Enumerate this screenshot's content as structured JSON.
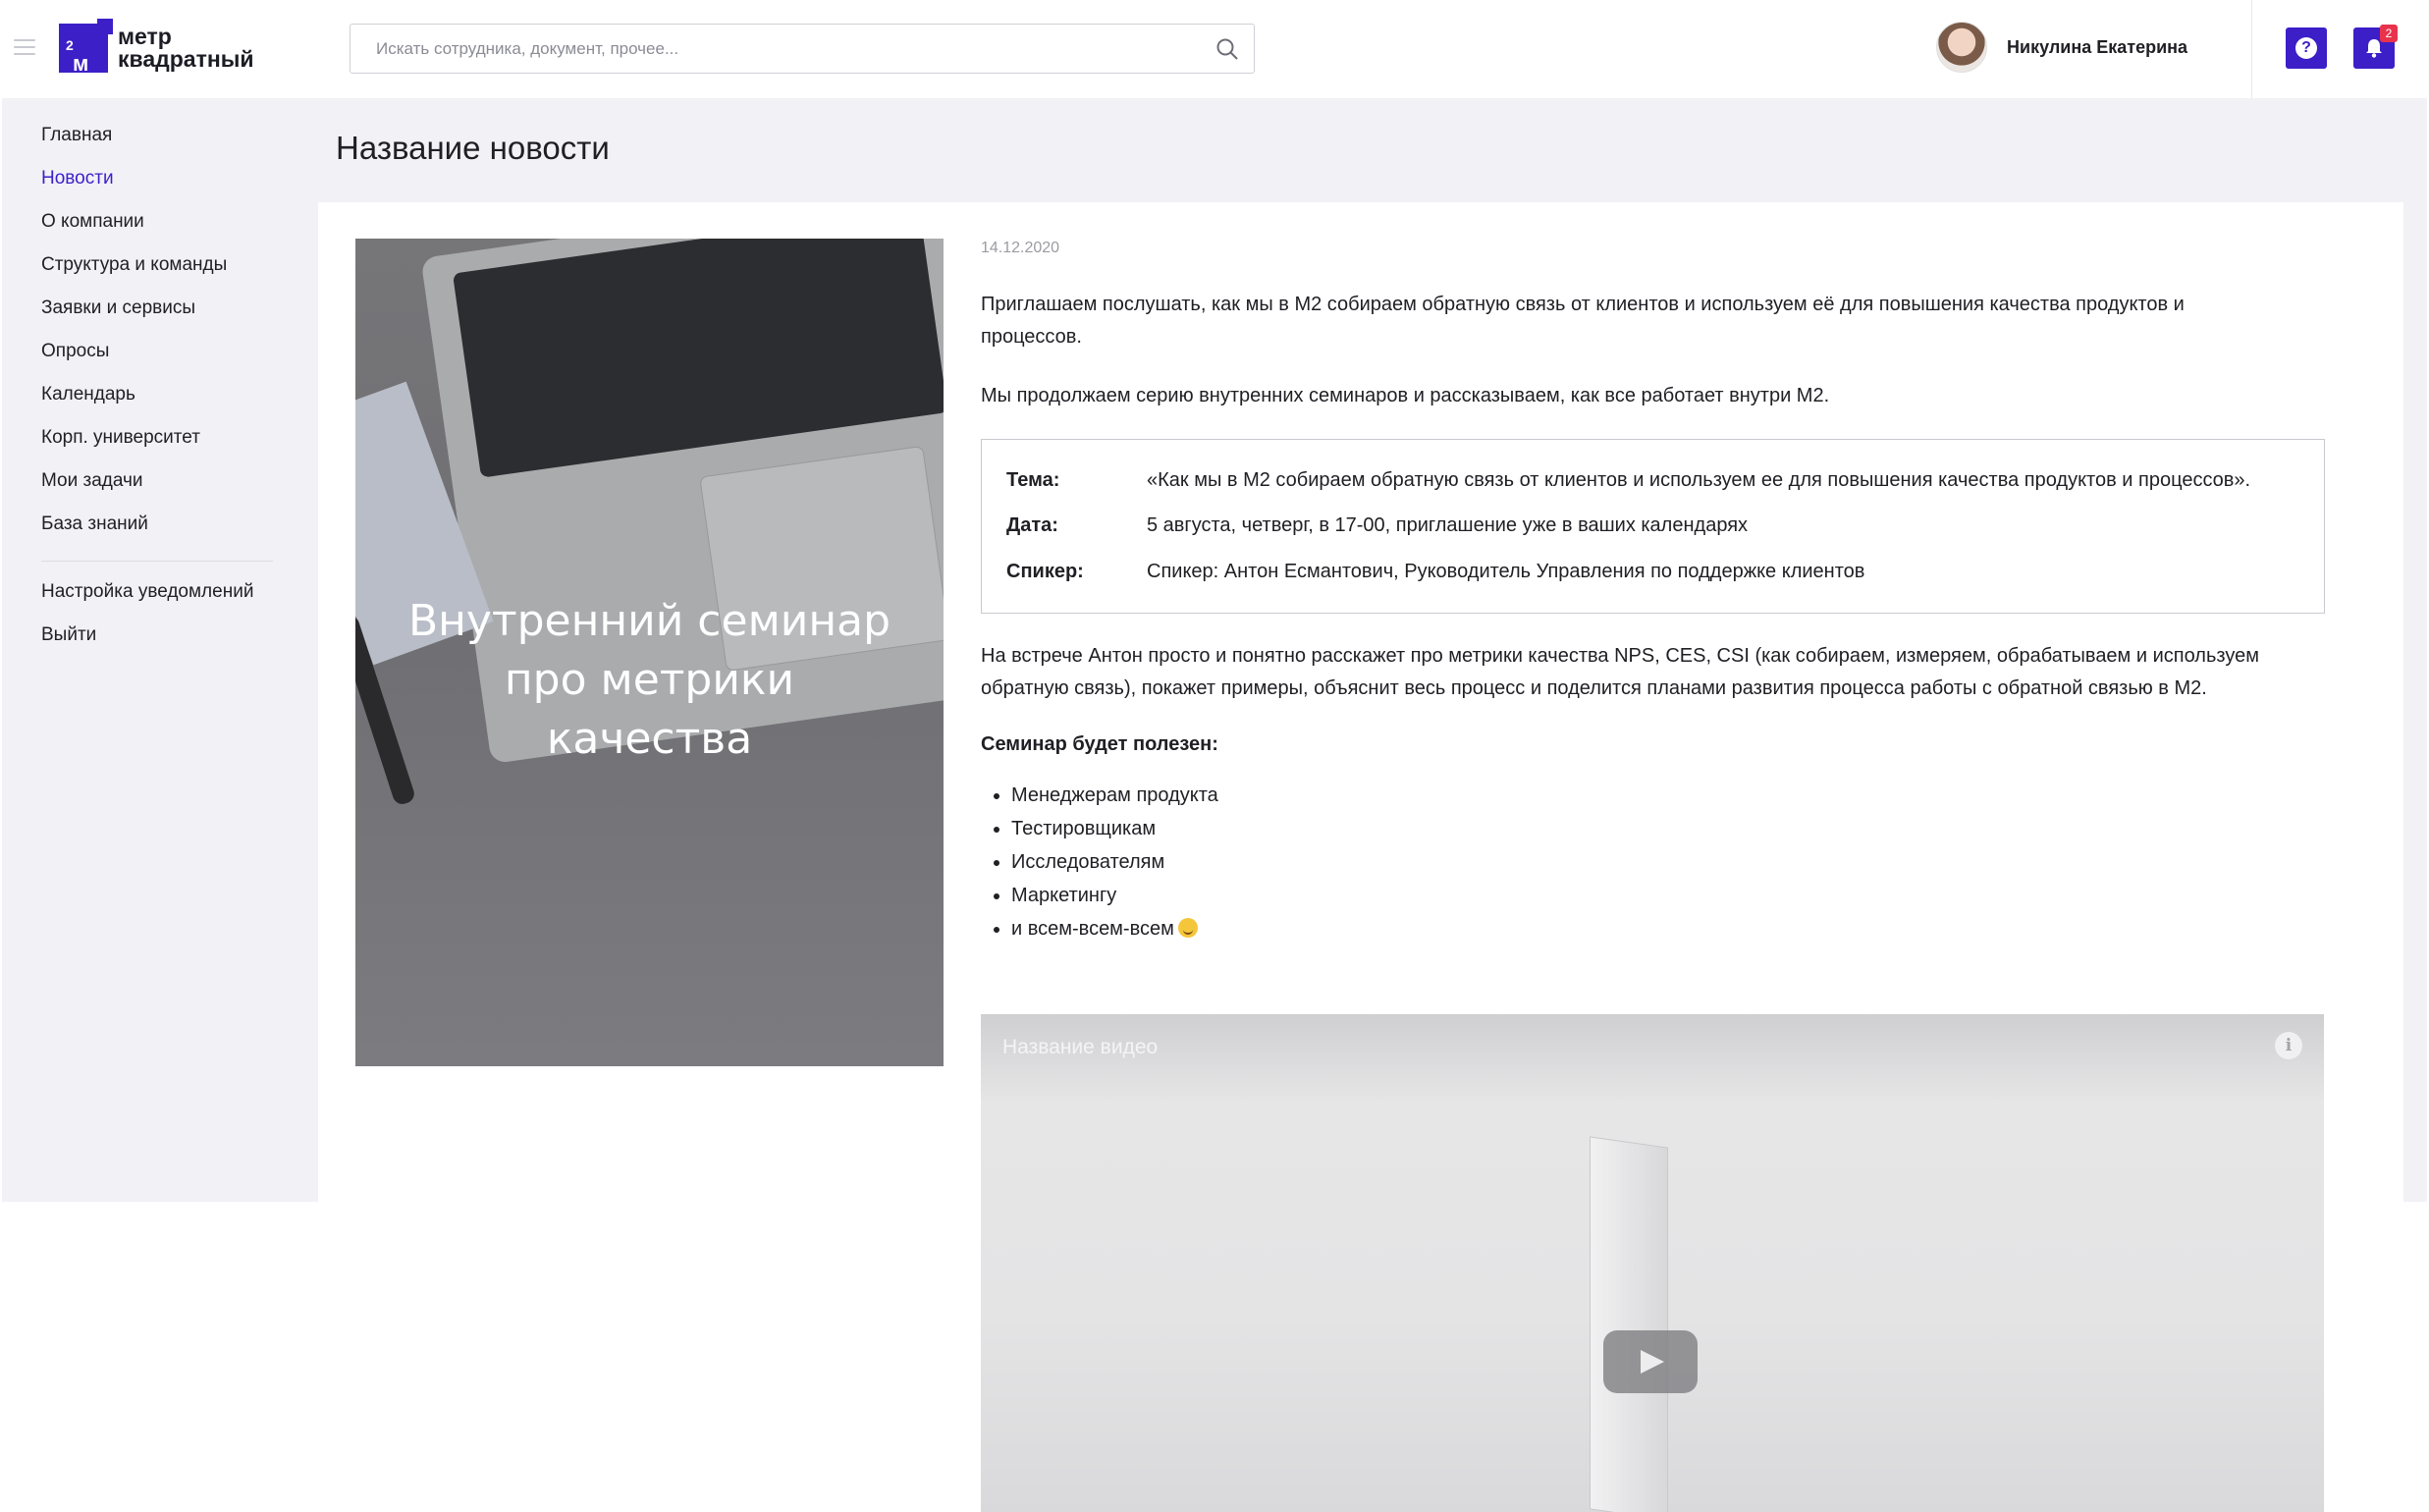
{
  "brand": {
    "logo_mark": "м",
    "logo_sup": "2",
    "logo_line1": "метр",
    "logo_line2": "квадратный",
    "accent": "#3d1fc8"
  },
  "search": {
    "placeholder": "Искать сотрудника, документ, прочее..."
  },
  "user": {
    "name": "Никулина Екатерина"
  },
  "header": {
    "help_label": "?",
    "notifications_count": "2"
  },
  "sidebar": {
    "items": [
      {
        "label": "Главная"
      },
      {
        "label": "Новости",
        "active": true
      },
      {
        "label": "О компании"
      },
      {
        "label": "Структура и команды"
      },
      {
        "label": "Заявки и сервисы"
      },
      {
        "label": "Опросы"
      },
      {
        "label": "Календарь"
      },
      {
        "label": "Корп. университет"
      },
      {
        "label": "Мои задачи"
      },
      {
        "label": "База знаний"
      }
    ],
    "footer_items": [
      {
        "label": "Настройка уведомлений"
      },
      {
        "label": "Выйти"
      }
    ]
  },
  "page": {
    "title": "Название новости"
  },
  "hero": {
    "line1": "Внутренний семинар",
    "line2": "про метрики",
    "line3": "качества"
  },
  "article": {
    "date": "14.12.2020",
    "intro_line1": "Приглашаем послушать, как мы в М2 собираем обратную связь от клиентов и используем её для повышения качества продуктов и",
    "intro_line2": "процессов.",
    "series": "Мы продолжаем серию внутренних семинаров и рассказываем, как все работает внутри М2.",
    "info": {
      "topic_label": "Тема:",
      "topic_value": "«Как мы в М2 собираем обратную связь от клиентов и используем ее для повышения качества продуктов и процессов».",
      "date_label": "Дата:",
      "date_value": "5 августа, четверг, в 17-00, приглашение уже в ваших календарях",
      "speaker_label": "Спикер:",
      "speaker_value": "Спикер: Антон Есмантович, Руководитель Управления по поддержке клиентов"
    },
    "body_line1": "На встрече Антон просто и понятно расскажет про метрики качества NPS, CES, CSI (как собираем, измеряем, обрабатываем и используем",
    "body_line2": "обратную связь), покажет примеры, объяснит весь процесс и поделится планами развития процесса работы с обратной связью в М2.",
    "useful_title": "Семинар будет полезен:",
    "useful_list": [
      "Менеджерам продукта",
      "Тестировщикам",
      "Исследователям",
      "Маркетингу",
      "и всем-всем-всем"
    ]
  },
  "video": {
    "title": "Название видео",
    "info_label": "i"
  }
}
